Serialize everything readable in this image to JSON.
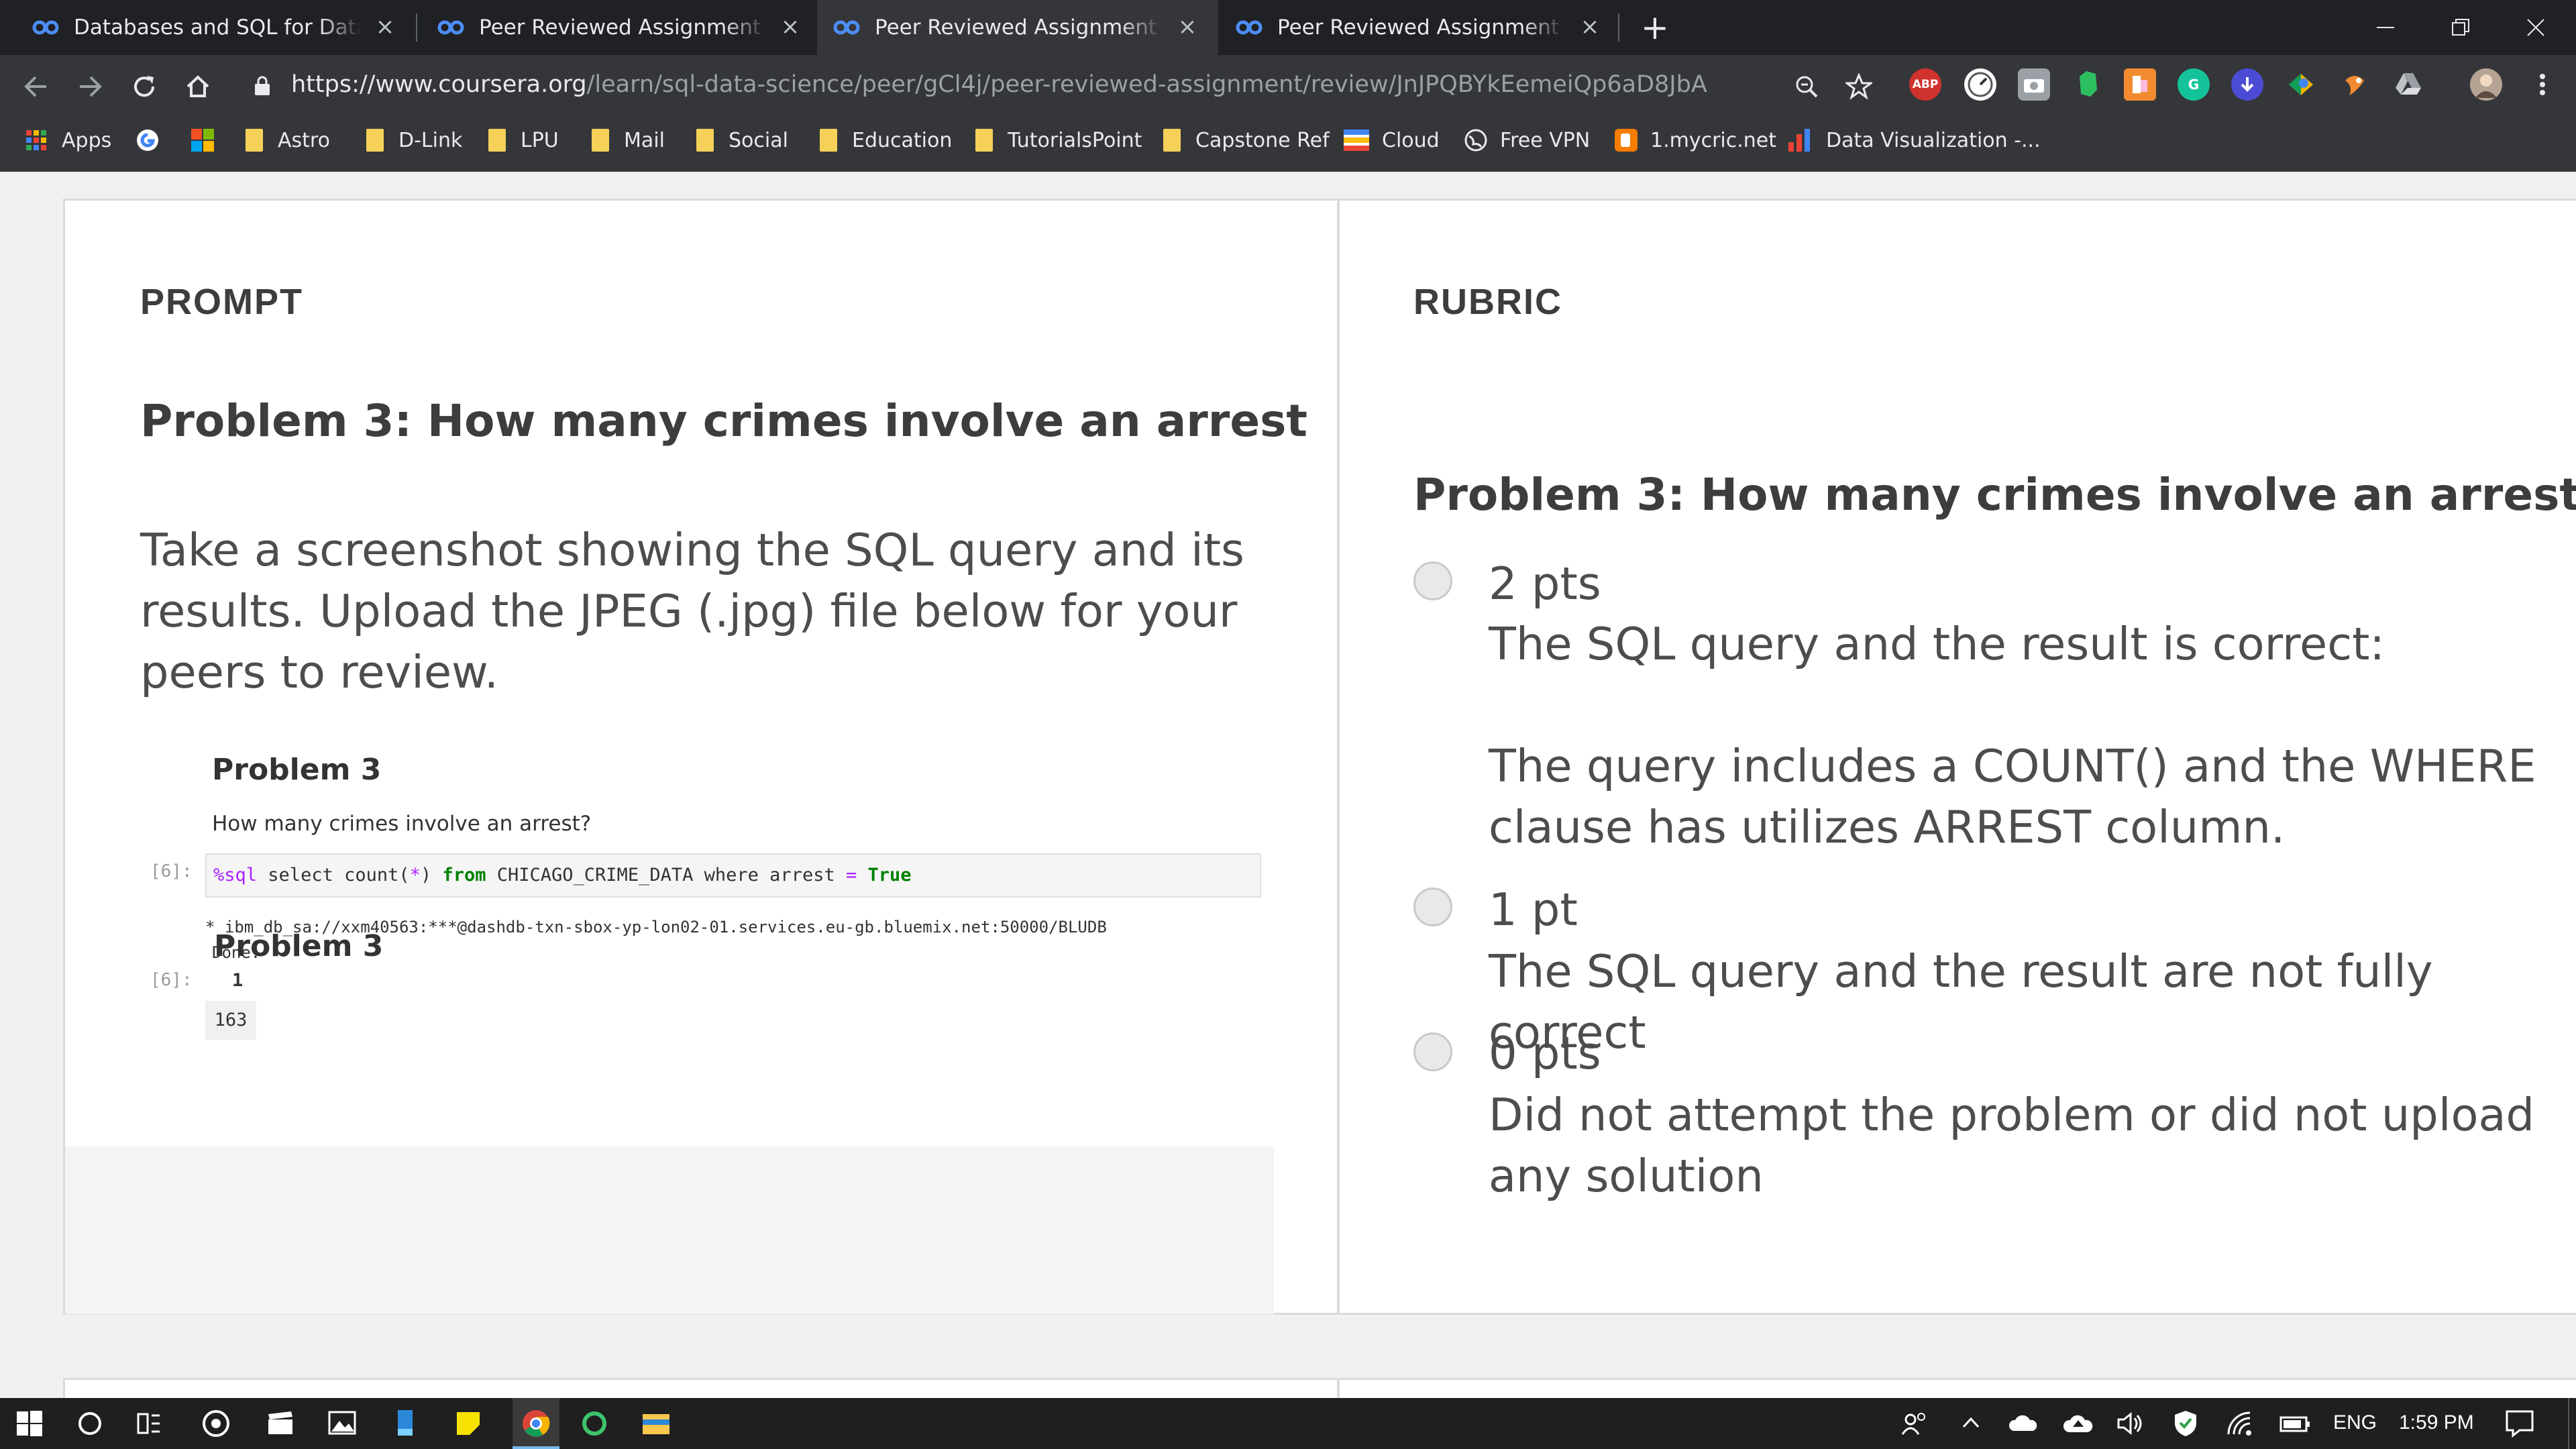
{
  "browser": {
    "tabs": [
      {
        "title": "Databases and SQL for Data Science",
        "active": false
      },
      {
        "title": "Peer Reviewed Assignment | Coursera",
        "active": false
      },
      {
        "title": "Peer Reviewed Assignment | Coursera",
        "active": true
      },
      {
        "title": "Peer Reviewed Assignment | Coursera",
        "active": false
      }
    ],
    "new_tab": "+",
    "url_host": "https://www.coursera.org",
    "url_path": "/learn/sql-data-science/peer/gCl4j/peer-reviewed-assignment/review/JnJPQBYkEemeiQp6aD8JbA",
    "extensions": [
      "ABP",
      "G",
      "B"
    ],
    "bookmarks": [
      "Apps",
      "Astro",
      "D-Link",
      "LPU",
      "Mail",
      "Social",
      "Education",
      "TutorialsPoint",
      "Capstone Ref",
      "Cloud",
      "Free VPN",
      "1.mycric.net",
      "Data Visualization -..."
    ]
  },
  "prompt": {
    "heading": "PROMPT",
    "problem_title": "Problem 3: How many crimes involve an arrest",
    "body": "Take a screenshot showing the SQL query and its results. Upload the JPEG (.jpg) file below for your peers to review.",
    "notebook": {
      "heading": "Problem 3",
      "question": "How many crimes involve an arrest?",
      "in_label": "[6]:",
      "out_label": "[6]:",
      "code_magic": "%sql",
      "code_kw1": "select",
      "code_fn": "count(",
      "code_star": "*",
      "code_close": ")",
      "code_from": "from",
      "code_table": "CHICAGO_CRIME_DATA",
      "code_where": "where",
      "code_col": "arrest",
      "code_eq": "=",
      "code_true": "True",
      "conn_line": " * ibm_db_sa://xxm40563:***@dashdb-txn-sbox-yp-lon02-01.services.eu-gb.bluemix.net:50000/BLUDB",
      "done_line": "Done.",
      "result_header": "1",
      "result_value": "163"
    }
  },
  "rubric": {
    "heading": "RUBRIC",
    "problem_title": "Problem 3: How many crimes involve an arrest",
    "options": [
      {
        "points": "2 pts",
        "desc1": "The SQL query and the result is correct:",
        "desc2": "The query includes a COUNT() and the WHERE clause has utilizes ARREST column."
      },
      {
        "points": "1 pt",
        "desc1": "The SQL query and the result are not fully correct"
      },
      {
        "points": "0 pts",
        "desc1": "Did not attempt the problem or did not upload any solution"
      }
    ]
  },
  "taskbar": {
    "language": "ENG",
    "time": "1:59 PM"
  },
  "colors": {
    "chrome_dark": "#202124",
    "chrome_toolbar": "#35363a",
    "text_main": "#4d4d4d",
    "heading": "#3d3d3d",
    "coursera_blue": "#2a73cc"
  }
}
